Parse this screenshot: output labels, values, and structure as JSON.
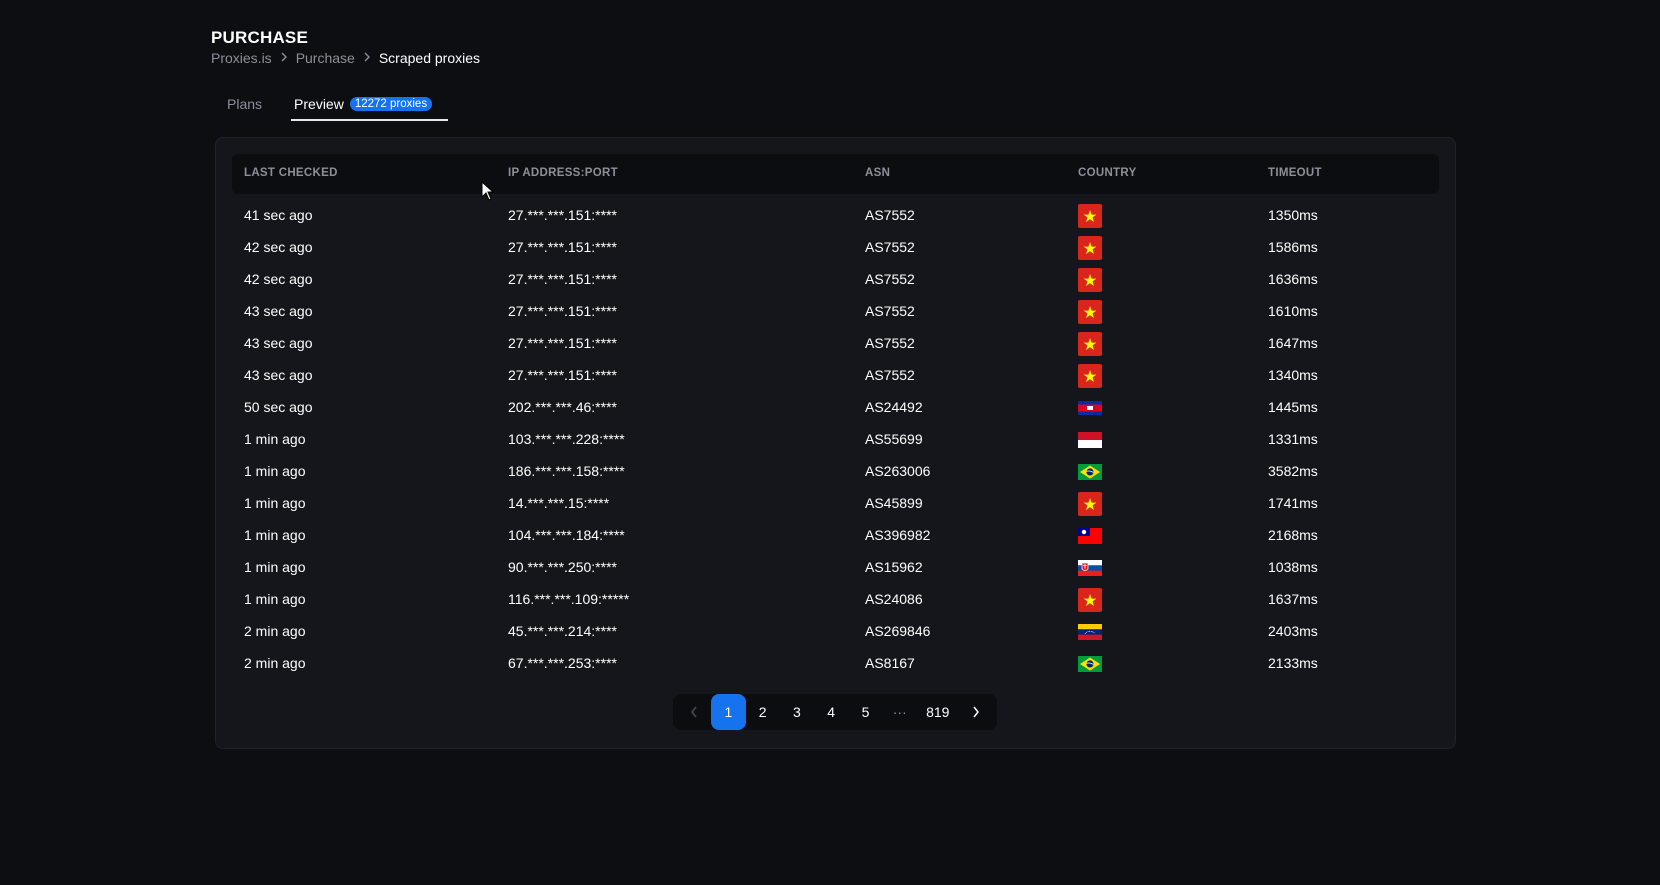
{
  "header": {
    "title": "PURCHASE",
    "breadcrumb": [
      "Proxies.is",
      "Purchase",
      "Scraped proxies"
    ]
  },
  "tabs": [
    {
      "label": "Plans"
    },
    {
      "label": "Preview",
      "badge": "12272 proxies"
    }
  ],
  "table": {
    "columns": [
      "LAST CHECKED",
      "IP ADDRESS:PORT",
      "ASN",
      "COUNTRY",
      "TIMEOUT"
    ],
    "rows": [
      {
        "last_checked": "41 sec ago",
        "ip": "27.***.***.151:****",
        "asn": "AS7552",
        "country": "vietnam-flag-icon",
        "timeout": "1350ms"
      },
      {
        "last_checked": "42 sec ago",
        "ip": "27.***.***.151:****",
        "asn": "AS7552",
        "country": "vietnam-flag-icon",
        "timeout": "1586ms"
      },
      {
        "last_checked": "42 sec ago",
        "ip": "27.***.***.151:****",
        "asn": "AS7552",
        "country": "vietnam-flag-icon",
        "timeout": "1636ms"
      },
      {
        "last_checked": "43 sec ago",
        "ip": "27.***.***.151:****",
        "asn": "AS7552",
        "country": "vietnam-flag-icon",
        "timeout": "1610ms"
      },
      {
        "last_checked": "43 sec ago",
        "ip": "27.***.***.151:****",
        "asn": "AS7552",
        "country": "vietnam-flag-icon",
        "timeout": "1647ms"
      },
      {
        "last_checked": "43 sec ago",
        "ip": "27.***.***.151:****",
        "asn": "AS7552",
        "country": "vietnam-flag-icon",
        "timeout": "1340ms"
      },
      {
        "last_checked": "50 sec ago",
        "ip": "202.***.***.46:****",
        "asn": "AS24492",
        "country": "cambodia-flag-icon",
        "timeout": "1445ms"
      },
      {
        "last_checked": "1 min ago",
        "ip": "103.***.***.228:****",
        "asn": "AS55699",
        "country": "indonesia-flag-icon",
        "timeout": "1331ms"
      },
      {
        "last_checked": "1 min ago",
        "ip": "186.***.***.158:****",
        "asn": "AS263006",
        "country": "brazil-flag-icon",
        "timeout": "3582ms"
      },
      {
        "last_checked": "1 min ago",
        "ip": "14.***.***.15:****",
        "asn": "AS45899",
        "country": "vietnam-flag-icon",
        "timeout": "1741ms"
      },
      {
        "last_checked": "1 min ago",
        "ip": "104.***.***.184:****",
        "asn": "AS396982",
        "country": "taiwan-flag-icon",
        "timeout": "2168ms"
      },
      {
        "last_checked": "1 min ago",
        "ip": "90.***.***.250:****",
        "asn": "AS15962",
        "country": "slovakia-flag-icon",
        "timeout": "1038ms"
      },
      {
        "last_checked": "1 min ago",
        "ip": "116.***.***.109:*****",
        "asn": "AS24086",
        "country": "vietnam-flag-icon",
        "timeout": "1637ms"
      },
      {
        "last_checked": "2 min ago",
        "ip": "45.***.***.214:****",
        "asn": "AS269846",
        "country": "venezuela-flag-icon",
        "timeout": "2403ms"
      },
      {
        "last_checked": "2 min ago",
        "ip": "67.***.***.253:****",
        "asn": "AS8167",
        "country": "brazil-flag-icon",
        "timeout": "2133ms"
      }
    ]
  },
  "pagination": {
    "prev_icon": "chevron-left-icon",
    "next_icon": "chevron-right-icon",
    "pages": [
      "1",
      "2",
      "3",
      "4",
      "5"
    ],
    "ellipsis": "···",
    "last": "819",
    "current": "1"
  },
  "colors": {
    "background": "#0d0e12",
    "card": "#14161c",
    "accent": "#1673f0",
    "muted_text": "#8d8f99"
  }
}
